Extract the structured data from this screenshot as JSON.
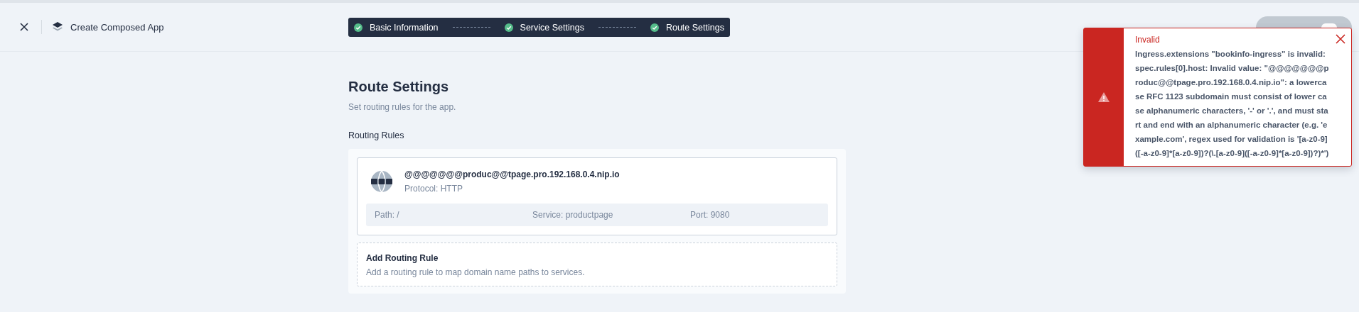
{
  "header": {
    "title": "Create Composed App"
  },
  "steps": [
    {
      "label": "Basic Information",
      "done": true
    },
    {
      "label": "Service Settings",
      "done": true
    },
    {
      "label": "Route Settings",
      "done": true
    }
  ],
  "page": {
    "title": "Route Settings",
    "subtitle": "Set routing rules for the app.",
    "section": "Routing Rules"
  },
  "rules": [
    {
      "host": "@@@@@@@produc@@tpage.pro.192.168.0.4.nip.io",
      "protocol": "Protocol: HTTP",
      "path": "Path: /",
      "service": "Service: productpage",
      "port": "Port: 9080"
    }
  ],
  "add_rule": {
    "title": "Add Routing Rule",
    "description": "Add a routing rule to map domain name paths to services."
  },
  "toast": {
    "title": "Invalid",
    "message": "Ingress.extensions \"bookinfo-ingress\" is invalid: spec.rules[0].host: Invalid value: \"@@@@@@@produc@@tpage.pro.192.168.0.4.nip.io\": a lowercase RFC 1123 subdomain must consist of lower case alphanumeric characters, '-' or '.', and must start and end with an alphanumeric character (e.g. 'example.com', regex used for validation is '[a-z0-9]([-a-z0-9]*[a-z0-9])?(\\.[a-z0-9]([-a-z0-9]*[a-z0-9])?)*')"
  }
}
